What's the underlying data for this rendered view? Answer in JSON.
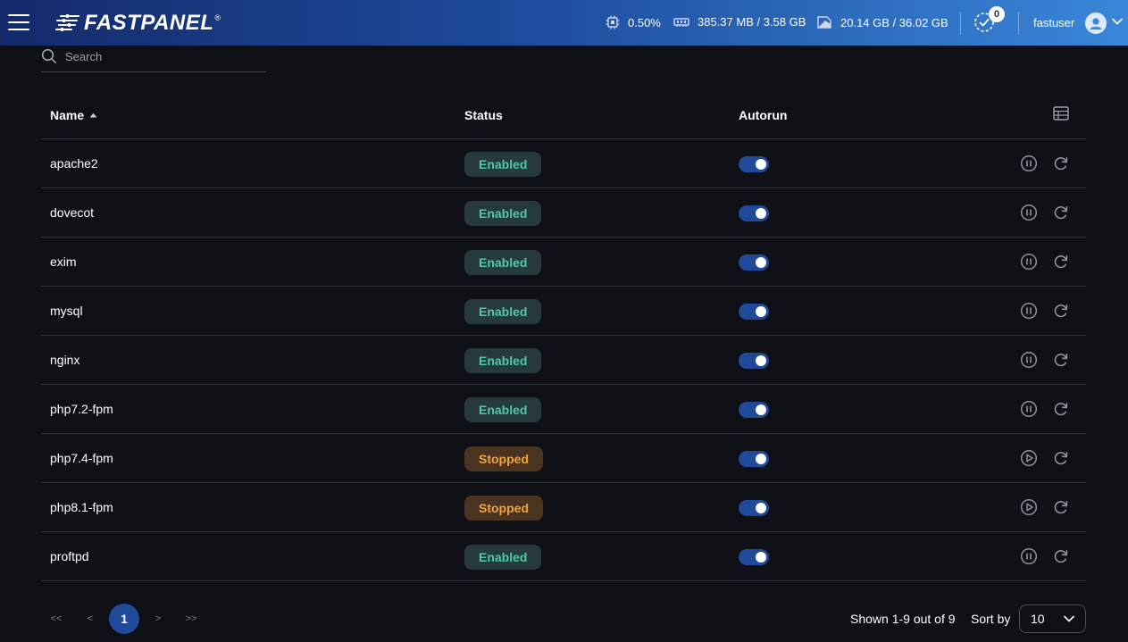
{
  "header": {
    "brand": "FASTPANEL",
    "brand_mark": "®",
    "cpu": "0.50%",
    "ram": "385.37 MB / 3.58 GB",
    "disk": "20.14 GB / 36.02 GB",
    "tasks_count": "0",
    "username": "fastuser"
  },
  "search": {
    "placeholder": "Search",
    "value": ""
  },
  "table": {
    "headers": {
      "name": "Name",
      "status": "Status",
      "autorun": "Autorun"
    },
    "sort": {
      "column": "Name",
      "direction": "ascending"
    },
    "rows": [
      {
        "name": "apache2",
        "status": "Enabled",
        "autorun": true,
        "action": "pause"
      },
      {
        "name": "dovecot",
        "status": "Enabled",
        "autorun": true,
        "action": "pause"
      },
      {
        "name": "exim",
        "status": "Enabled",
        "autorun": true,
        "action": "pause"
      },
      {
        "name": "mysql",
        "status": "Enabled",
        "autorun": true,
        "action": "pause"
      },
      {
        "name": "nginx",
        "status": "Enabled",
        "autorun": true,
        "action": "pause"
      },
      {
        "name": "php7.2-fpm",
        "status": "Enabled",
        "autorun": true,
        "action": "pause"
      },
      {
        "name": "php7.4-fpm",
        "status": "Stopped",
        "autorun": true,
        "action": "play"
      },
      {
        "name": "php8.1-fpm",
        "status": "Stopped",
        "autorun": true,
        "action": "play"
      },
      {
        "name": "proftpd",
        "status": "Enabled",
        "autorun": true,
        "action": "pause"
      }
    ]
  },
  "pagination": {
    "first": "<<",
    "prev": "<",
    "current_page": "1",
    "next": ">",
    "last": ">>",
    "shown_text": "Shown 1-9 out of 9",
    "sort_by_label": "Sort by",
    "page_size": "10"
  },
  "colors": {
    "header_gradient_start": "#142a6b",
    "header_gradient_end": "#3a86d8",
    "background": "#0f1015",
    "accent": "#1f4a9a",
    "enabled_text": "#4fc9a6",
    "enabled_bg": "#263a3d",
    "stopped_text": "#f2a340",
    "stopped_bg": "#4a3420"
  },
  "icons": {
    "menu": "hamburger-icon",
    "cpu": "cpu-icon",
    "ram": "memory-icon",
    "disk": "disk-icon",
    "tasks": "tasks-check-icon",
    "user": "user-avatar-icon",
    "search": "search-icon",
    "columns": "table-columns-icon",
    "pause": "pause-circle-icon",
    "play": "play-circle-icon",
    "restart": "restart-icon"
  }
}
